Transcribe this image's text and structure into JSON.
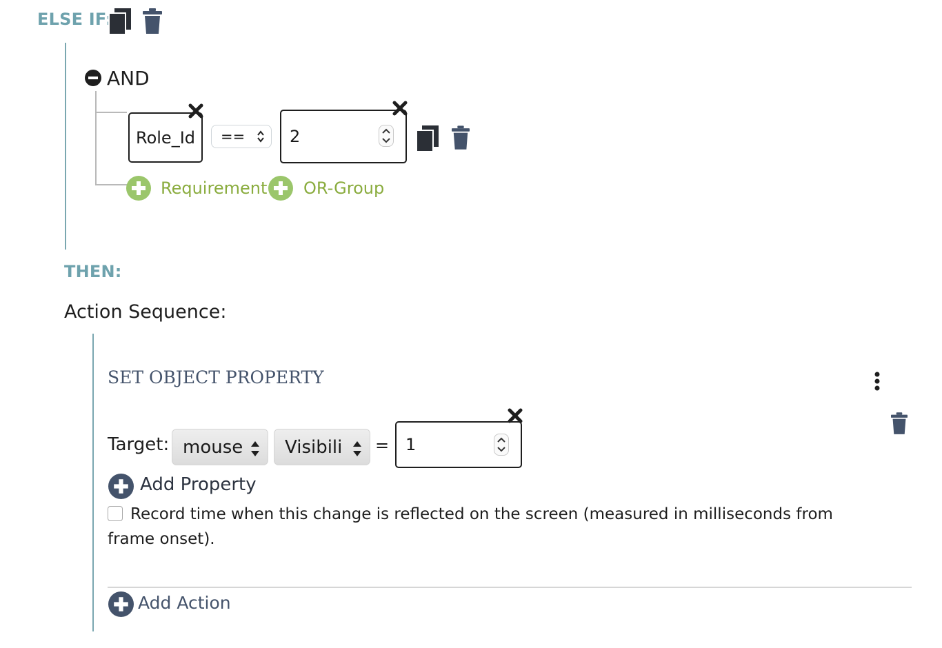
{
  "else_if": {
    "label": "ELSE IF:",
    "icons": [
      "copy-icon",
      "trash-icon"
    ]
  },
  "and_group": {
    "label": "AND",
    "icon": "minus-circle-icon",
    "condition": {
      "variable": "Role_Id",
      "operator": "==",
      "value": "2"
    },
    "add_requirement_label": "Requirement",
    "add_or_group_label": "OR-Group"
  },
  "then": {
    "label": "THEN:",
    "action_sequence_label": "Action Sequence:"
  },
  "action": {
    "title": "SET OBJECT PROPERTY",
    "target_label": "Target:",
    "target_object": "mouse",
    "target_property": "Visibili",
    "equals": "=",
    "value": "1",
    "add_property_label": "Add Property",
    "record_time_text": "Record time when this change is reflected on the screen (measured in milliseconds from frame onset).",
    "record_time_checked": false
  },
  "add_action_label": "Add Action",
  "colors": {
    "teal": "#6ea2ad",
    "green": "#8aac3e",
    "navy": "#44536b",
    "dark": "#2c3340"
  }
}
